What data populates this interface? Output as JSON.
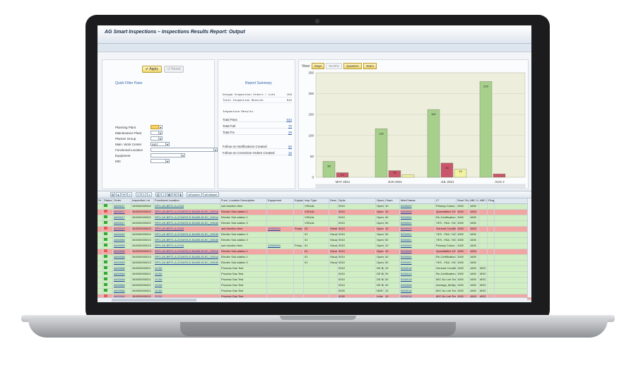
{
  "app": {
    "title": "AG Smart Inspections – Inspections Results Report: Output"
  },
  "filter": {
    "apply_label": "Apply",
    "reset_label": "Reset",
    "pane_title": "Quick Filter Pane",
    "fields": [
      {
        "label": "Planning Plant",
        "value": ""
      },
      {
        "label": "Maintenance Plant",
        "value": ""
      },
      {
        "label": "Planner Group",
        "value": ""
      },
      {
        "label": "Main. Work Center",
        "value": "BIST"
      },
      {
        "label": "Functional Location",
        "value": ""
      },
      {
        "label": "Equipment",
        "value": ""
      },
      {
        "label": "MIC",
        "value": ""
      }
    ]
  },
  "summary": {
    "title": "Report Summary",
    "unique_label": "Unique Inspection Orders / Lots",
    "unique_value": "104",
    "total_label": "Total Inspection Records",
    "total_value": "642",
    "results_heading": "Inspection Results",
    "pass_label": "Total Pass",
    "pass_value": "543",
    "fail_label": "Total Fail",
    "fail_value": "70",
    "fix_label": "Total Fix",
    "fix_value": "29",
    "notif_label": "Follow-on Notifications Created",
    "notif_value": "50",
    "corr_label": "Follow-on Corrective Orders Created",
    "corr_value": "15"
  },
  "view": {
    "label": "View:",
    "buttons": [
      "Days",
      "Months",
      "Quarters",
      "Years"
    ],
    "active": "Days"
  },
  "chart_data": {
    "type": "bar",
    "categories": [
      "MAY 2021",
      "JUN 2021",
      "JUL 2021",
      "AUG 2"
    ],
    "series": [
      {
        "values": [
          38,
          116,
          162,
          229
        ],
        "color": "#a8d08d"
      },
      {
        "values": [
          11,
          16,
          34,
          8
        ],
        "color": "#c9566a"
      },
      {
        "values": [
          0,
          6,
          19,
          0
        ],
        "color": "#f2f2a0"
      }
    ],
    "labels": [
      [
        "38",
        "11",
        ""
      ],
      [
        "116",
        "16",
        ""
      ],
      [
        "162",
        "34",
        "19"
      ],
      [
        "229",
        "",
        ""
      ]
    ],
    "ylim": [
      0,
      250
    ],
    "yticks": [
      0,
      50,
      100,
      150,
      200,
      250
    ],
    "grid": true
  },
  "grid": {
    "toolbar_expand": "Expand",
    "toolbar_collapse": "Collapse",
    "headers": [
      "St",
      "Status",
      "Order",
      "Inspection Lot",
      "Functional Location",
      "Func. Location Description",
      "Equipment",
      "Equipment Description",
      "Insp Type",
      "Desc",
      "OpAc",
      "Operation Short Text",
      "Charc",
      "MstrCharac",
      "LT",
      "Short Text",
      "ABC Indic.",
      "ABC Indicator",
      "Plng Plant",
      "MntPlant",
      "PlannerGr"
    ],
    "rows": [
      {
        "c": "g",
        "order": "4600047",
        "lot": "340000000002",
        "floc": "SPG-UK-BRT1-A-2234",
        "desc": "sub function item",
        "equip": "",
        "edesc": "",
        "itype": "VISUAL",
        "op": "0010",
        "opt": "Operation - 1",
        "charc": "10",
        "mic": "0000009",
        "st": "Primary Colors",
        "p1": "1000",
        "p2": "1600",
        "pg": ""
      },
      {
        "c": "r",
        "order": "4600047",
        "lot": "340000000002",
        "floc": "SPG-UK-BRT1-A-2234/SS-E-B4405-ELEC_0001A",
        "desc": "Electric Sub-station 1",
        "equip": "",
        "edesc": "",
        "itype": "VISUAL",
        "op": "0010",
        "opt": "Operation - 1",
        "charc": "20",
        "mic": "0000008",
        "st": "Quantitative 10% - 20%",
        "p1": "1000",
        "p2": "1600",
        "pg": ""
      },
      {
        "c": "g",
        "order": "4600047",
        "lot": "340000000002",
        "floc": "SPG-UK-BRT1-A-2234/SS-E-B4405-ELEC_0001A",
        "desc": "Electric Sub-station 1",
        "equip": "",
        "edesc": "",
        "itype": "VISUAL",
        "op": "0010",
        "opt": "Operation - 1",
        "charc": "40",
        "mic": "0000004",
        "st": "Re-Certification Date",
        "p1": "1000",
        "p2": "1600",
        "pg": ""
      },
      {
        "c": "g",
        "order": "4600047",
        "lot": "340000000002",
        "floc": "SPG-UK-BRT1-A-2234/SS-E-B4405-ELEC_0001B",
        "desc": "Electric Sub-station 2",
        "equip": "",
        "edesc": "",
        "itype": "VISUAL",
        "op": "0010",
        "opt": "Operation - 1",
        "charc": "50",
        "mic": "0000001",
        "st": "YES - FAIL / NO - PASS",
        "p1": "1000",
        "p2": "1600",
        "pg": ""
      },
      {
        "c": "r",
        "order": "4600049",
        "lot": "340000000003",
        "floc": "SPG-UK-BRT1-A-2234",
        "desc": "sub function item",
        "equip": "10000000",
        "edesc": "Pump",
        "itype": "03",
        "idesc": "Detailed Inspection",
        "op": "0010",
        "opt": "Operation - 1",
        "charc": "10",
        "mic": "0000009",
        "st": "General Condition P/F/F",
        "p1": "1000",
        "p2": "1600",
        "pg": ""
      },
      {
        "c": "g",
        "order": "4600049",
        "lot": "340000000010",
        "floc": "SPG-UK-BRT1-A-2234/SS-E-B4405-ELEC_0001B",
        "desc": "Electric Sub-station 2",
        "equip": "",
        "edesc": "",
        "itype": "01",
        "idesc": "Visual Inspection",
        "op": "0010",
        "opt": "Operation - 1",
        "charc": "30",
        "mic": "0000001",
        "st": "YES - FAIL / NO - PASS",
        "p1": "1000",
        "p2": "1600",
        "pg": ""
      },
      {
        "c": "g",
        "order": "4600056",
        "lot": "340000000010",
        "floc": "SPG-UK-BRT1-A-2234/SS-E-B4405-ELEC_0001B",
        "desc": "Electric Sub-station 2",
        "equip": "",
        "edesc": "",
        "itype": "01",
        "idesc": "Visual Inspection",
        "op": "0010",
        "opt": "Operation - 1",
        "charc": "50",
        "mic": "0000001",
        "st": "YES - FAIL / NO - PASS",
        "p1": "1000",
        "p2": "1600",
        "pg": ""
      },
      {
        "c": "g",
        "order": "4600058",
        "lot": "340000000013",
        "floc": "SPG-UK-BRT1-A-2234",
        "desc": "sub function item",
        "equip": "10000000",
        "edesc": "Pump",
        "itype": "01",
        "idesc": "Visual Inspection",
        "op": "0010",
        "opt": "Operation - 1",
        "charc": "10",
        "mic": "0000009",
        "st": "Primary Colors",
        "p1": "1000",
        "p2": "1600",
        "pg": ""
      },
      {
        "c": "r",
        "order": "4600058",
        "lot": "340000000013",
        "floc": "SPG-UK-BRT1-A-2234/SS-E-B4405-ELEC_0001A",
        "desc": "Electric Sub-station 1",
        "equip": "",
        "edesc": "",
        "itype": "01",
        "idesc": "Visual Inspection",
        "op": "0010",
        "opt": "Operation - 1",
        "charc": "20",
        "mic": "0000008",
        "st": "Quantitative 10% - 20%",
        "p1": "1000",
        "p2": "1600",
        "pg": ""
      },
      {
        "c": "g",
        "order": "4600058",
        "lot": "340000000013",
        "floc": "SPG-UK-BRT1-A-2234/SS-E-B4405-ELEC_0001A",
        "desc": "Electric Sub-station 1",
        "equip": "",
        "edesc": "",
        "itype": "01",
        "idesc": "Visual Inspection",
        "op": "0010",
        "opt": "Operation - 1",
        "charc": "40",
        "mic": "0000004",
        "st": "Re-Certification Date",
        "p1": "1000",
        "p2": "1600",
        "pg": ""
      },
      {
        "c": "g",
        "order": "4600058",
        "lot": "340000000013",
        "floc": "SPG-UK-BRT1-A-2234/SS-E-B4405-ELEC_0001B",
        "desc": "Electric Sub-station 2",
        "equip": "",
        "edesc": "",
        "itype": "01",
        "idesc": "Visual Inspection",
        "op": "0010",
        "opt": "Operation - 1",
        "charc": "50",
        "mic": "0000001",
        "st": "YES - FAIL / NO - PASS",
        "p1": "1000",
        "p2": "1600",
        "pg": ""
      },
      {
        "c": "g",
        "order": "4600068",
        "lot": "340000000021",
        "floc": "OC50",
        "desc": "Process Gas Test",
        "equip": "",
        "edesc": "",
        "itype": "",
        "op": "0010",
        "opt": "DE Bearing Temp check",
        "charc": "10",
        "mic": "0000018",
        "st": "General Condition P/F/F",
        "p1": "1000",
        "p2": "1600",
        "pg": "MSC"
      },
      {
        "c": "g",
        "order": "4600068",
        "lot": "340000000021",
        "floc": "OC50",
        "desc": "Process Gas Test",
        "equip": "",
        "edesc": "",
        "itype": "",
        "op": "0010",
        "opt": "DE Bearing Temp check",
        "charc": "20",
        "mic": "0000019",
        "st": "Re-Certification Date",
        "p1": "1000",
        "p2": "1600",
        "pg": "MSC"
      },
      {
        "c": "g",
        "order": "4600068",
        "lot": "340000000021",
        "floc": "OC50",
        "desc": "Process Gas Test",
        "equip": "",
        "edesc": "",
        "itype": "",
        "op": "0010",
        "opt": "DE Bearing Temp check",
        "charc": "30",
        "mic": "0000018",
        "st": "MIC No Lmt Test",
        "p1": "1000",
        "p2": "1600",
        "pg": "MSC"
      },
      {
        "c": "g",
        "order": "4600068",
        "lot": "340000000021",
        "floc": "OC50",
        "desc": "Process Gas Test",
        "equip": "",
        "edesc": "",
        "itype": "",
        "op": "0010",
        "opt": "DE Bearing Temp check",
        "charc": "40",
        "mic": "0000006",
        "st": "Average_Multiple",
        "p1": "1000",
        "p2": "1600",
        "pg": "MSC"
      },
      {
        "c": "g",
        "order": "4600068",
        "lot": "340000000021",
        "floc": "OC50",
        "desc": "Process Gas Test",
        "equip": "",
        "edesc": "",
        "itype": "",
        "op": "0020",
        "opt": "NDE Bearing Temp check",
        "charc": "10",
        "mic": "0000018",
        "st": "MIC No Lmt Test",
        "p1": "1000",
        "p2": "1600",
        "pg": "MSC"
      },
      {
        "c": "r",
        "order": "4600068",
        "lot": "340000000021",
        "floc": "OC50",
        "desc": "Process Gas Test",
        "equip": "",
        "edesc": "",
        "itype": "",
        "op": "0030",
        "opt": "Lube Oil level check",
        "charc": "10",
        "mic": "0000018",
        "st": "MIC No Lmt Test",
        "p1": "1000",
        "p2": "1600",
        "pg": "MSC"
      },
      {
        "c": "g",
        "order": "4600068",
        "lot": "340000000021",
        "floc": "OC50",
        "desc": "Process Gas Test",
        "equip": "",
        "edesc": "",
        "itype": "",
        "op": "0040",
        "opt": "Cooling water leakage check",
        "charc": "10",
        "mic": "0000019",
        "st": "General Condition P/F/F",
        "p1": "1000",
        "p2": "1600",
        "pg": "MSC"
      },
      {
        "c": "g",
        "order": "4600068",
        "lot": "340000000021",
        "floc": "OC50",
        "desc": "Process Gas Test",
        "equip": "",
        "edesc": "",
        "itype": "",
        "op": "0040",
        "opt": "Cooling water leakage check",
        "charc": "20",
        "mic": "0000018",
        "st": "MIC No Lmt Test",
        "p1": "1000",
        "p2": "1600",
        "pg": "MSC"
      },
      {
        "c": "r",
        "order": "4600068",
        "lot": "340000000021",
        "floc": "OC50",
        "desc": "Process Gas Test",
        "equip": "",
        "edesc": "",
        "itype": "",
        "op": "0050",
        "opt": "Vibration check",
        "charc": "90",
        "mic": "0000018",
        "st": "MIC No Lmt Test",
        "p1": "1000",
        "p2": "1600",
        "pg": "MSC"
      },
      {
        "c": "g",
        "order": "4600068",
        "lot": "340000000021",
        "floc": "OC50",
        "desc": "Process Gas Test",
        "equip": "",
        "edesc": "",
        "itype": "",
        "op": "0050",
        "opt": "Vibration check",
        "charc": "30",
        "mic": "0000001",
        "st": "YES - FAIL / NO - PASS",
        "p1": "1000",
        "p2": "1600",
        "pg": "MSC"
      }
    ]
  }
}
